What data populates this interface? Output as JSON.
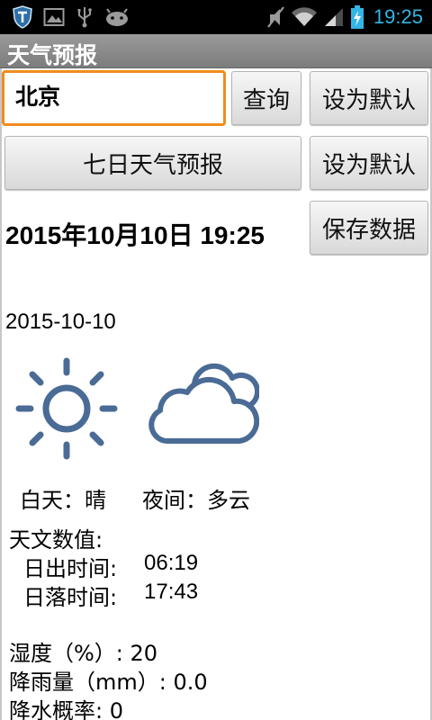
{
  "status_bar": {
    "time": "19:25",
    "icons": [
      "shield-icon",
      "image-icon",
      "usb-icon",
      "android-icon",
      "mute-icon",
      "wifi-icon",
      "signal-icon",
      "battery-charging-icon"
    ]
  },
  "title_bar": {
    "title": "天气预报"
  },
  "controls": {
    "city_value": "北京",
    "query_button": "查询",
    "set_default_button_1": "设为默认",
    "week_forecast_button": "七日天气预报",
    "set_default_button_2": "设为默认",
    "save_data_button": "保存数据"
  },
  "weather": {
    "datetime": "2015年10月10日 19:25",
    "date": "2015-10-10",
    "day_icon": "sun-icon",
    "night_icon": "cloud-icon",
    "day_text": "白天：晴",
    "night_text": "夜间：多云",
    "astronomy_title": "天文数值:",
    "sunrise_label": "日出时间:",
    "sunrise_value": "06:19",
    "sunset_label": "日落时间:",
    "sunset_value": "17:43",
    "humidity": "湿度（%）: 20",
    "rainfall": "降雨量（mm）: 0.0",
    "rain_probability": "降水概率: 0"
  },
  "colors": {
    "status_bar_bg": "#000000",
    "clock": "#33b5e5",
    "title_bar_bg": "#8a8a8a",
    "input_focus_border": "#f08c1c",
    "weather_icon": "#4a6b95"
  }
}
